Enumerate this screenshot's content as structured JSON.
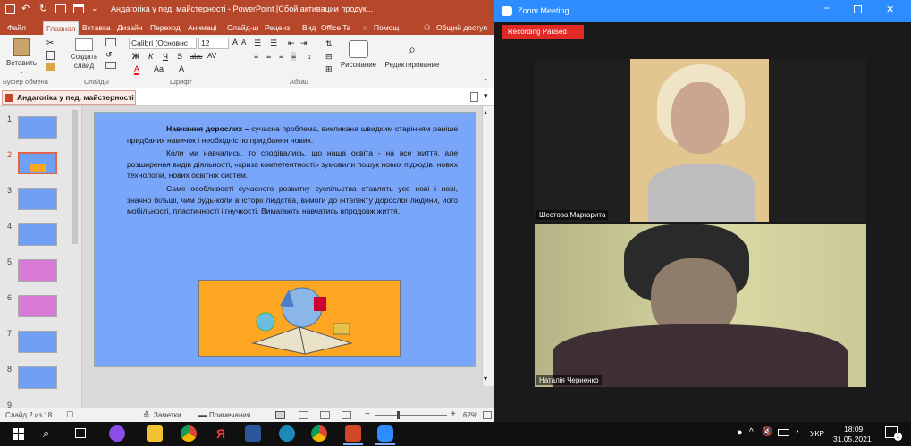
{
  "powerpoint": {
    "title": "Андагогіка у пед. майстерності - PowerPoint [Сбой активации продук...",
    "tabs": [
      "Файл",
      "Главная",
      "Вставка",
      "Дизайн",
      "Переход",
      "Анимаці",
      "Слайд-ш",
      "Реценз",
      "Вид",
      "Office Ta"
    ],
    "help": "Помощ",
    "share": "Общий доступ",
    "ribbon": {
      "paste": "Вставить",
      "new_slide": "Создать слайд",
      "font_name": "Calibri (Основнс",
      "font_size": "12",
      "draw": "Рисование",
      "edit": "Редактирование",
      "groups": [
        "Буфер обмена",
        "Слайды",
        "Шрифт",
        "Абзац"
      ]
    },
    "doc_tab": "Андагогіка у пед. майстерності",
    "thumb_numbers": [
      "1",
      "2",
      "3",
      "4",
      "5",
      "6",
      "7",
      "8",
      "9"
    ],
    "slide": {
      "p1_bold": "Навчання дорослих –",
      "p1": " сучасна проблема, викликана швидким старінням раніше придбаних навичок і необхідністю придбання нових.",
      "p2": "Коли ми навчались, то сподівались, що наша освіта - на все життя, але розширення видів діяльності, «криза компетентності» зумовили пошук нових підходів, нових технологій, нових освітніх систем.",
      "p3": "Саме особливості сучасного розвитку суспільства ставлять усе нові і нові, значно більші, чим будь-коли в історії людства, вимоги до інтелекту дорослої людини, його мобільності, пластичності і гнучкості. Вимагають навчатись впродовж життя."
    },
    "status": {
      "slide": "Слайд 2 из 18",
      "notes": "Заметки",
      "comments": "Примечания",
      "zoom": "62%"
    }
  },
  "zoom": {
    "title": "Zoom Meeting",
    "recording": "Recording Paused",
    "participants": [
      "Шестова Маргарита",
      "Наталія Черненко"
    ]
  },
  "taskbar": {
    "lang": "УКР",
    "time": "18:09",
    "date": "31.05.2021",
    "notif": "1"
  }
}
